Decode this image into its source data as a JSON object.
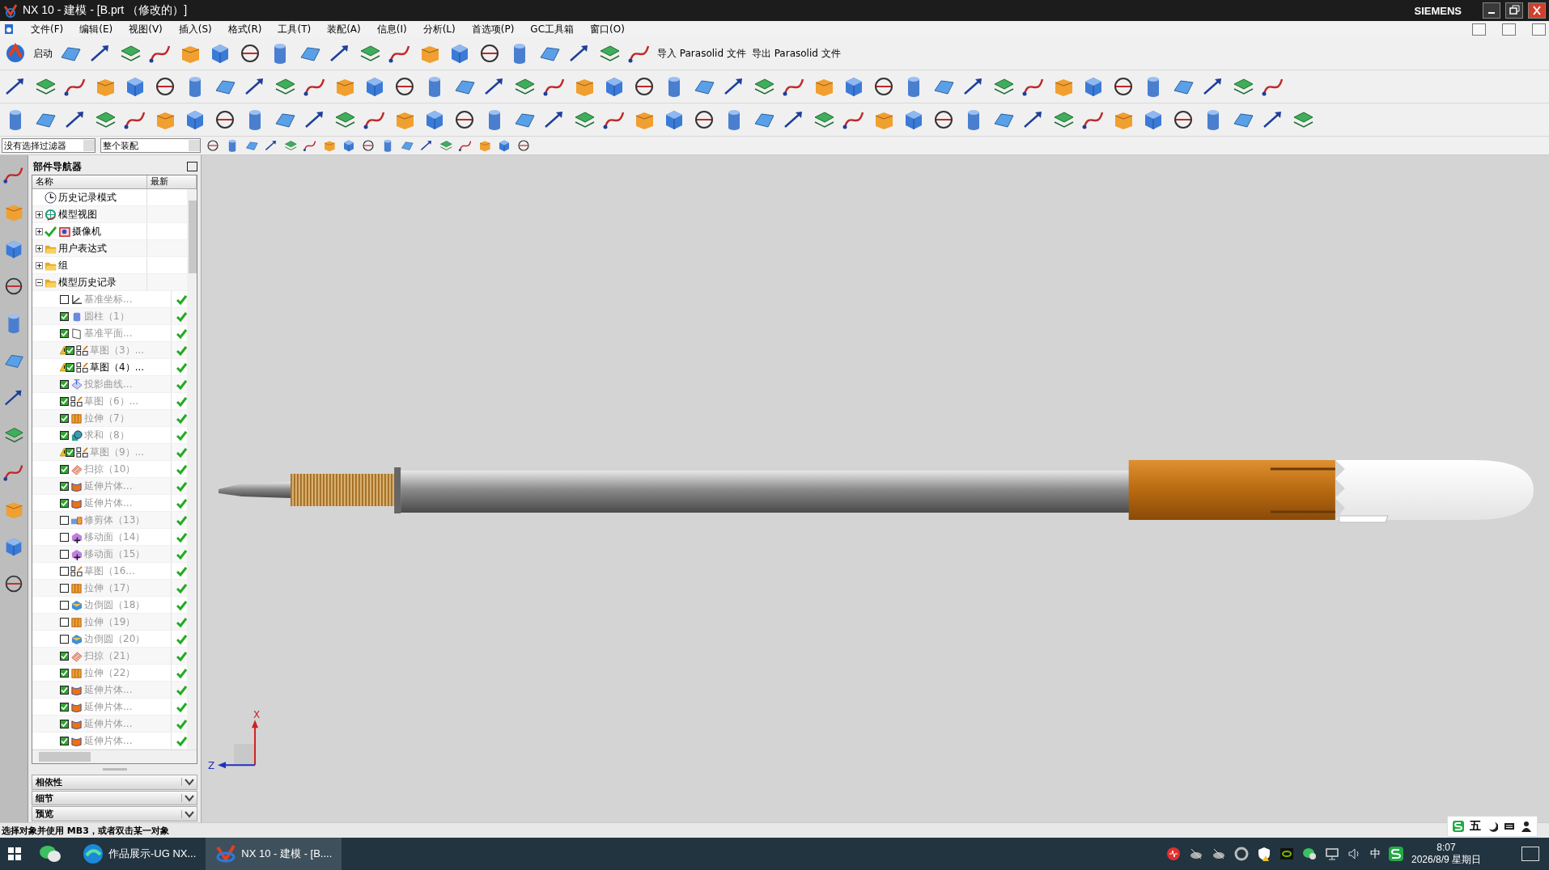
{
  "window": {
    "title": "NX 10 - 建模 - [B.prt （修改的）]",
    "brand": "SIEMENS"
  },
  "menu": [
    "文件(F)",
    "编辑(E)",
    "视图(V)",
    "插入(S)",
    "格式(R)",
    "工具(T)",
    "装配(A)",
    "信息(I)",
    "分析(L)",
    "首选项(P)",
    "GC工具箱",
    "窗口(O)"
  ],
  "toolbar": {
    "start_label": "启动",
    "import_label": "导入 Parasolid 文件",
    "export_label": "导出 Parasolid 文件"
  },
  "selection_bar": {
    "filter": "没有选择过滤器",
    "scope": "整个装配"
  },
  "navigator": {
    "title": "部件导航器",
    "columns": [
      "名称",
      "最新"
    ],
    "items": [
      {
        "label": "历史记录模式",
        "kind": "clock"
      },
      {
        "label": "模型视图",
        "kind": "views",
        "expanded": false
      },
      {
        "label": "摄像机",
        "kind": "camera",
        "expanded": false
      },
      {
        "label": "用户表达式",
        "kind": "folder",
        "expanded": false
      },
      {
        "label": "组",
        "kind": "folder",
        "expanded": false
      },
      {
        "label": "模型历史记录",
        "kind": "folder",
        "expanded": true,
        "children": [
          {
            "label": "基准坐标...",
            "kind": "csys",
            "checked": false,
            "warning": false,
            "dimmed": true,
            "up_to_date": true
          },
          {
            "label": "圆柱（1）",
            "kind": "cylinder",
            "checked": true,
            "warning": false,
            "dimmed": true,
            "up_to_date": true
          },
          {
            "label": "基准平面...",
            "kind": "plane",
            "checked": true,
            "warning": false,
            "dimmed": true,
            "up_to_date": true
          },
          {
            "label": "草图（3）...",
            "kind": "sketch",
            "checked": true,
            "warning": true,
            "dimmed": true,
            "up_to_date": true
          },
          {
            "label": "草图（4）...",
            "kind": "sketch",
            "checked": true,
            "warning": true,
            "dimmed": false,
            "up_to_date": true
          },
          {
            "label": "投影曲线...",
            "kind": "curve",
            "checked": true,
            "warning": false,
            "dimmed": true,
            "up_to_date": true
          },
          {
            "label": "草图（6）...",
            "kind": "sketch",
            "checked": true,
            "warning": false,
            "dimmed": true,
            "up_to_date": true
          },
          {
            "label": "拉伸（7）",
            "kind": "extrude",
            "checked": true,
            "warning": false,
            "dimmed": true,
            "up_to_date": true
          },
          {
            "label": "求和（8）",
            "kind": "unite",
            "checked": true,
            "warning": false,
            "dimmed": true,
            "up_to_date": true
          },
          {
            "label": "草图（9）...",
            "kind": "sketch",
            "checked": true,
            "warning": true,
            "dimmed": true,
            "up_to_date": true
          },
          {
            "label": "扫掠（10）",
            "kind": "sweep",
            "checked": true,
            "warning": false,
            "dimmed": true,
            "up_to_date": true
          },
          {
            "label": "延伸片体...",
            "kind": "sheet",
            "checked": true,
            "warning": false,
            "dimmed": true,
            "up_to_date": true
          },
          {
            "label": "延伸片体...",
            "kind": "sheet",
            "checked": true,
            "warning": false,
            "dimmed": true,
            "up_to_date": true
          },
          {
            "label": "修剪体（13）",
            "kind": "trim",
            "checked": false,
            "warning": false,
            "dimmed": true,
            "up_to_date": true
          },
          {
            "label": "移动面（14）",
            "kind": "move",
            "checked": false,
            "warning": false,
            "dimmed": true,
            "up_to_date": true
          },
          {
            "label": "移动面（15）",
            "kind": "move",
            "checked": false,
            "warning": false,
            "dimmed": true,
            "up_to_date": true
          },
          {
            "label": "草图（16...",
            "kind": "sketch",
            "checked": false,
            "warning": false,
            "dimmed": true,
            "up_to_date": true
          },
          {
            "label": "拉伸（17）",
            "kind": "extrude",
            "checked": false,
            "warning": false,
            "dimmed": true,
            "up_to_date": true
          },
          {
            "label": "边倒圆（18）",
            "kind": "blend",
            "checked": false,
            "warning": false,
            "dimmed": true,
            "up_to_date": true
          },
          {
            "label": "拉伸（19）",
            "kind": "extrude",
            "checked": false,
            "warning": false,
            "dimmed": true,
            "up_to_date": true
          },
          {
            "label": "边倒圆（20）",
            "kind": "blend",
            "checked": false,
            "warning": false,
            "dimmed": true,
            "up_to_date": true
          },
          {
            "label": "扫掠（21）",
            "kind": "sweep",
            "checked": true,
            "warning": false,
            "dimmed": true,
            "up_to_date": true
          },
          {
            "label": "拉伸（22）",
            "kind": "extrude",
            "checked": true,
            "warning": false,
            "dimmed": true,
            "up_to_date": true
          },
          {
            "label": "延伸片体...",
            "kind": "sheet",
            "checked": true,
            "warning": false,
            "dimmed": true,
            "up_to_date": true
          },
          {
            "label": "延伸片体...",
            "kind": "sheet",
            "checked": true,
            "warning": false,
            "dimmed": true,
            "up_to_date": true
          },
          {
            "label": "延伸片体...",
            "kind": "sheet",
            "checked": true,
            "warning": false,
            "dimmed": true,
            "up_to_date": true
          },
          {
            "label": "延伸片体...",
            "kind": "sheet",
            "checked": true,
            "warning": false,
            "dimmed": true,
            "up_to_date": true
          }
        ]
      }
    ],
    "panels": [
      {
        "label": "相依性",
        "expanded": false
      },
      {
        "label": "细节",
        "expanded": false
      },
      {
        "label": "预览",
        "expanded": false
      }
    ]
  },
  "triad": {
    "x_label": "X",
    "z_label": "Z"
  },
  "status_bar": {
    "prompt": "选择对象并使用 MB3，或者双击某一对象"
  },
  "ime": {
    "mode": "五"
  },
  "taskbar": {
    "apps": [
      {
        "label": "作品展示-UG NX...",
        "kind": "browser",
        "selected": false
      },
      {
        "label": "NX 10 - 建模 - [B....",
        "kind": "nx",
        "selected": true
      }
    ],
    "language": "中",
    "time": "8:07",
    "date": "2026/8/9 星期日"
  }
}
